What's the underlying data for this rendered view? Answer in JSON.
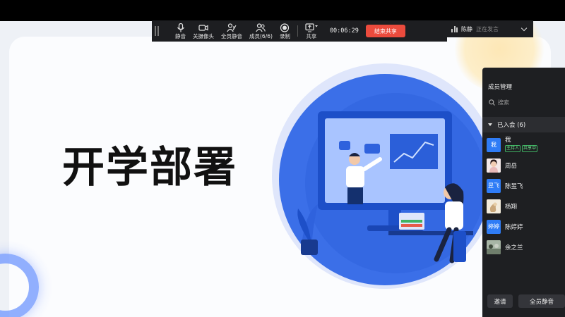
{
  "slide": {
    "title": "开学部署"
  },
  "toolbar": {
    "mute_label": "静音",
    "camera_label": "关摄像头",
    "mute_all_label": "全员静音",
    "members_label": "成员(6/6)",
    "record_label": "录制",
    "share_label": "共享",
    "timer": "00:06:29",
    "end_share_label": "结束共享"
  },
  "speaking": {
    "name": "陈静",
    "status": "正在发言"
  },
  "panel": {
    "title": "成员管理",
    "search_placeholder": "搜索",
    "group_label": "已入会 (6)",
    "me": {
      "avatar_text": "我",
      "name": "我",
      "badges": [
        "主持人",
        "共享中"
      ]
    },
    "members": [
      {
        "name": "周岳",
        "avatar_text": ""
      },
      {
        "name": "陈昱飞",
        "avatar_text": "昱飞"
      },
      {
        "name": "杨翔",
        "avatar_text": ""
      },
      {
        "name": "陈婷婷",
        "avatar_text": "婷婷"
      },
      {
        "name": "余之兰",
        "avatar_text": ""
      }
    ],
    "invite_label": "邀请",
    "mute_all_label": "全员静音"
  },
  "colors": {
    "toolbar_bg": "#1d1e21",
    "end_share": "#eb4b3d",
    "avatar_blue": "#2f7cf6",
    "accent_blue": "#3b6fe8"
  }
}
